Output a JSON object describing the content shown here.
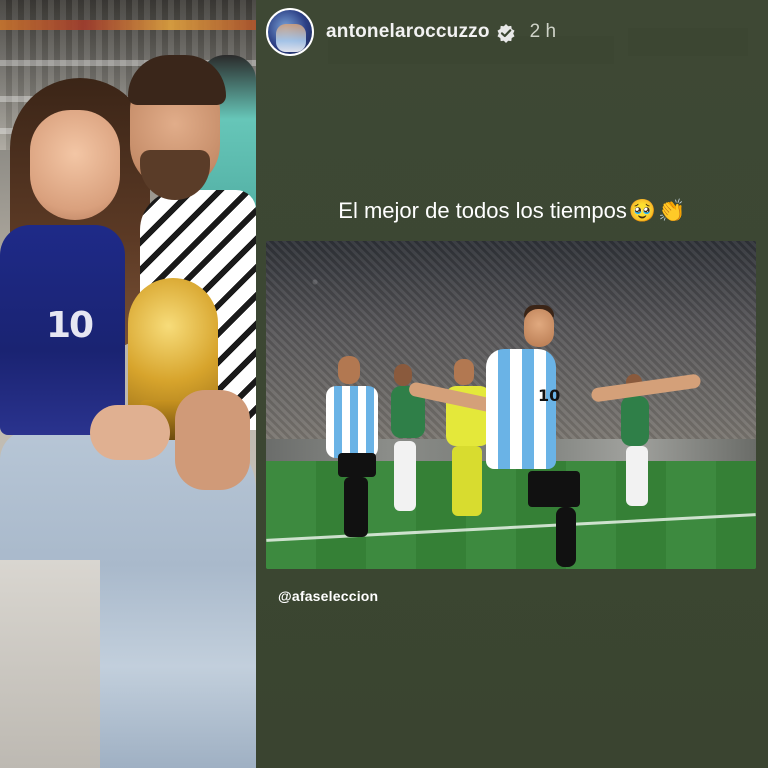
{
  "header": {
    "username": "antonelaroccuzzo",
    "verified": true,
    "time": "2 h"
  },
  "caption": {
    "text": "El mejor de todos los tiempos",
    "emojis": [
      "🥹",
      "👏"
    ]
  },
  "mention": "@afaseleccion",
  "images": {
    "left_photo": "couple-with-trophy-photo",
    "story_photo": "football-celebration-photo"
  },
  "colors": {
    "story_background": "#3c4733",
    "text": "#ffffff",
    "muted_text": "#cfd3c8",
    "verified_badge": "#3897f0"
  }
}
